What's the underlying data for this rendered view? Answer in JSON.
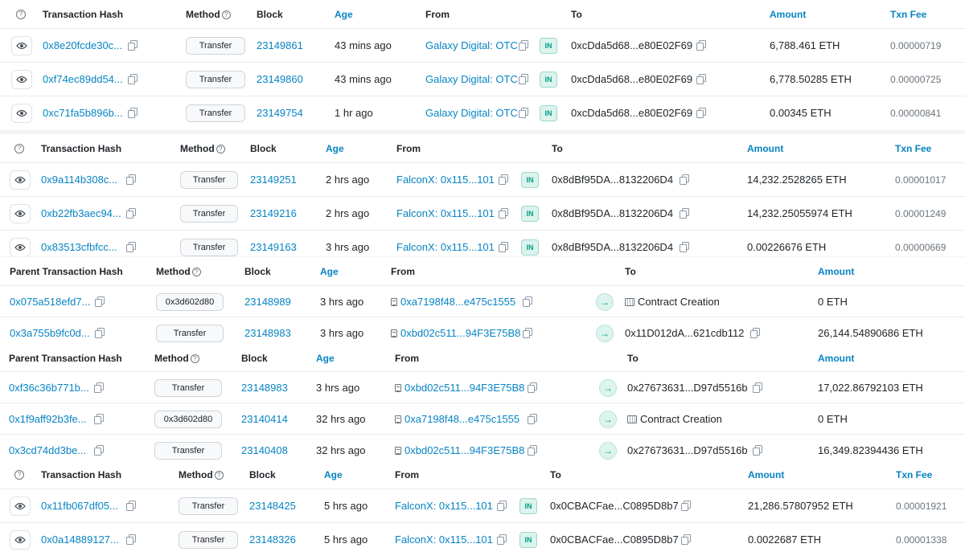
{
  "columns": {
    "txhash": "Transaction Hash",
    "parent_txhash": "Parent Transaction Hash",
    "method": "Method",
    "block": "Block",
    "age": "Age",
    "from": "From",
    "to": "To",
    "amount": "Amount",
    "txnfee": "Txn Fee"
  },
  "tables": [
    {
      "rows": [
        {
          "hash": "0x8e20fcde30c...",
          "method": "Transfer",
          "block": "23149861",
          "age": "43 mins ago",
          "from": "Galaxy Digital: OTC",
          "dir": "IN",
          "to": "0xcDda5d68...e80E02F69",
          "amount": "6,788.461 ETH",
          "fee": "0.00000719"
        },
        {
          "hash": "0xf74ec89dd54...",
          "method": "Transfer",
          "block": "23149860",
          "age": "43 mins ago",
          "from": "Galaxy Digital: OTC",
          "dir": "IN",
          "to": "0xcDda5d68...e80E02F69",
          "amount": "6,778.50285 ETH",
          "fee": "0.00000725"
        },
        {
          "hash": "0xc71fa5b896b...",
          "method": "Transfer",
          "block": "23149754",
          "age": "1 hr ago",
          "from": "Galaxy Digital: OTC",
          "dir": "IN",
          "to": "0xcDda5d68...e80E02F69",
          "amount": "0.00345 ETH",
          "fee": "0.00000841"
        }
      ]
    },
    {
      "rows": [
        {
          "hash": "0x9a114b308c...",
          "method": "Transfer",
          "block": "23149251",
          "age": "2 hrs ago",
          "from": "FalconX: 0x115...101",
          "dir": "IN",
          "to": "0x8dBf95DA...8132206D4",
          "amount": "14,232.2528265 ETH",
          "fee": "0.00001017"
        },
        {
          "hash": "0xb22fb3aec94...",
          "method": "Transfer",
          "block": "23149216",
          "age": "2 hrs ago",
          "from": "FalconX: 0x115...101",
          "dir": "IN",
          "to": "0x8dBf95DA...8132206D4",
          "amount": "14,232.25055974 ETH",
          "fee": "0.00001249"
        },
        {
          "hash": "0x83513cfbfcc...",
          "method": "Transfer",
          "block": "23149163",
          "age": "3 hrs ago",
          "from": "FalconX: 0x115...101",
          "dir": "IN",
          "to": "0x8dBf95DA...8132206D4",
          "amount": "0.00226676 ETH",
          "fee": "0.00000669"
        }
      ]
    },
    {
      "rows": [
        {
          "hash": "0x075a518efd7...",
          "method": "0x3d602d80",
          "block": "23148989",
          "age": "3 hrs ago",
          "from": "0xa7198f48...e475c1555",
          "to": "Contract Creation",
          "to_contract": true,
          "amount": "0 ETH"
        },
        {
          "hash": "0x3a755b9fc0d...",
          "method": "Transfer",
          "block": "23148983",
          "age": "3 hrs ago",
          "from": "0xbd02c511...94F3E75B8",
          "to": "0x11D012dA...621cdb112",
          "to_contract": false,
          "amount": "26,144.54890686 ETH"
        }
      ]
    },
    {
      "rows": [
        {
          "hash": "0xf36c36b771b...",
          "method": "Transfer",
          "block": "23148983",
          "age": "3 hrs ago",
          "from": "0xbd02c511...94F3E75B8",
          "to": "0x27673631...D97d5516b",
          "to_contract": false,
          "amount": "17,022.86792103 ETH"
        },
        {
          "hash": "0x1f9aff92b3fe...",
          "method": "0x3d602d80",
          "block": "23140414",
          "age": "32 hrs ago",
          "from": "0xa7198f48...e475c1555",
          "to": "Contract Creation",
          "to_contract": true,
          "amount": "0 ETH"
        },
        {
          "hash": "0x3cd74dd3be...",
          "method": "Transfer",
          "block": "23140408",
          "age": "32 hrs ago",
          "from": "0xbd02c511...94F3E75B8",
          "to": "0x27673631...D97d5516b",
          "to_contract": false,
          "amount": "16,349.82394436 ETH"
        }
      ]
    },
    {
      "rows": [
        {
          "hash": "0x11fb067df05...",
          "method": "Transfer",
          "block": "23148425",
          "age": "5 hrs ago",
          "from": "FalconX: 0x115...101",
          "dir": "IN",
          "to": "0x0CBACFae...C0895D8b7",
          "amount": "21,286.57807952 ETH",
          "fee": "0.00001921"
        },
        {
          "hash": "0x0a14889127...",
          "method": "Transfer",
          "block": "23148326",
          "age": "5 hrs ago",
          "from": "FalconX: 0x115...101",
          "dir": "IN",
          "to": "0x0CBACFae...C0895D8b7",
          "amount": "0.0022687 ETH",
          "fee": "0.00001338"
        }
      ]
    }
  ]
}
